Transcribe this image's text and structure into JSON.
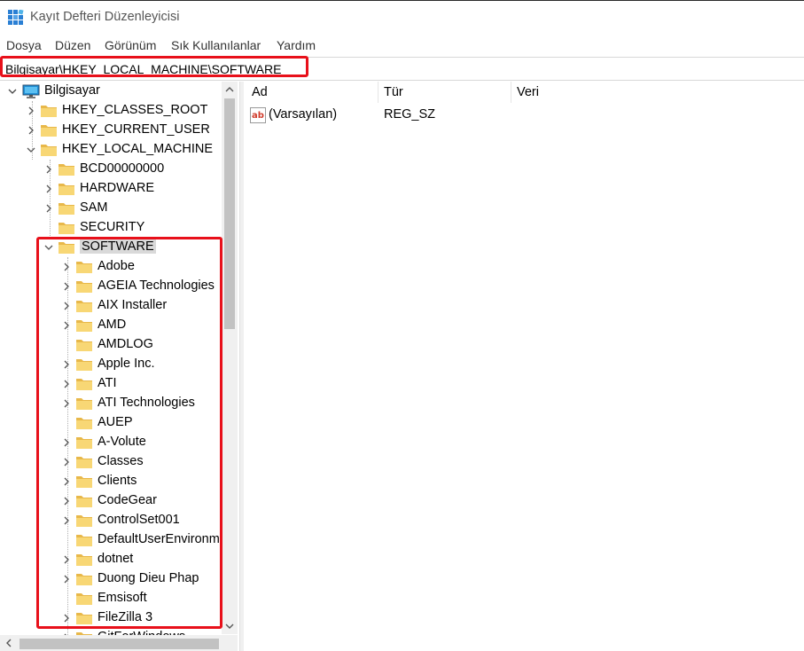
{
  "window": {
    "title": "Kayıt Defteri Düzenleyicisi"
  },
  "menu": [
    "Dosya",
    "Düzen",
    "Görünüm",
    "Sık Kullanılanlar",
    "Yardım"
  ],
  "address": "Bilgisayar\\HKEY_LOCAL_MACHINE\\SOFTWARE",
  "tree": {
    "root": "Bilgisayar",
    "hives": [
      "HKEY_CLASSES_ROOT",
      "HKEY_CURRENT_USER",
      "HKEY_LOCAL_MACHINE"
    ],
    "hklm_children": [
      "BCD00000000",
      "HARDWARE",
      "SAM",
      "SECURITY",
      "SOFTWARE"
    ],
    "software_children": [
      "Adobe",
      "AGEIA Technologies",
      "AIX Installer",
      "AMD",
      "AMDLOG",
      "Apple Inc.",
      "ATI",
      "ATI Technologies",
      "AUEP",
      "A-Volute",
      "Classes",
      "Clients",
      "CodeGear",
      "ControlSet001",
      "DefaultUserEnvironm",
      "dotnet",
      "Duong Dieu Phap",
      "Emsisoft",
      "FileZilla 3",
      "GitForWindows"
    ]
  },
  "list": {
    "columns": [
      "Ad",
      "Tür",
      "Veri"
    ],
    "rows": [
      {
        "name": "(Varsayılan)",
        "type": "REG_SZ",
        "data": ""
      }
    ]
  },
  "colors": {
    "highlight": "#e8101a",
    "folder": "#f8d775",
    "selection": "#d9d9d9"
  }
}
